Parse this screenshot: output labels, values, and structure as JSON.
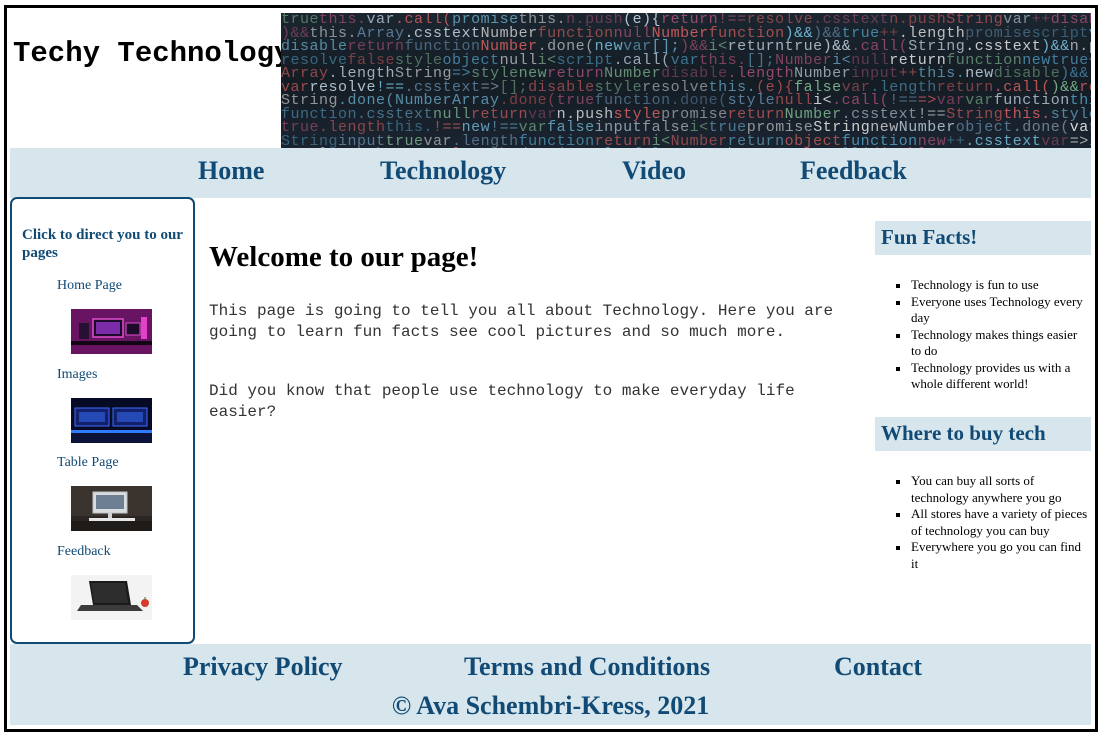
{
  "header": {
    "title": "Techy Technology"
  },
  "nav": {
    "items": [
      "Home",
      "Technology",
      "Video",
      "Feedback"
    ]
  },
  "sidebar": {
    "heading": "Click to direct you to our pages",
    "links": [
      {
        "label": "Home Page",
        "image": "gaming-setup-thumbnail"
      },
      {
        "label": "Images",
        "image": "monitors-thumbnail"
      },
      {
        "label": "Table Page",
        "image": "desk-computer-thumbnail"
      },
      {
        "label": "Feedback",
        "image": "laptop-thumbnail"
      }
    ]
  },
  "main": {
    "heading": "Welcome to our page!",
    "paragraphs": [
      "This page is going to tell you all about Technology. Here you are going to learn fun facts see cool pictures and so much more.",
      "Did you know that people use technology to make everyday life easier?"
    ]
  },
  "aside": {
    "fun_facts": {
      "heading": "Fun Facts!",
      "items": [
        "Technology is fun to use",
        "Everyone uses Technology every day",
        "Technology makes things easier to do",
        "Technology provides us with a whole different world!"
      ]
    },
    "where_to_buy": {
      "heading": "Where to buy tech",
      "items": [
        "You can buy all sorts of technology anywhere you go",
        "All stores have a variety of pieces of technology you can buy",
        "Everywhere you go you can find it"
      ]
    }
  },
  "footer": {
    "links": [
      "Privacy Policy",
      "Terms and Conditions",
      "Contact"
    ],
    "copyright": "© Ava Schembri-Kress, 2021"
  },
  "colors": {
    "accent": "#114a75",
    "band": "#d6e6ec",
    "text": "#000000"
  }
}
